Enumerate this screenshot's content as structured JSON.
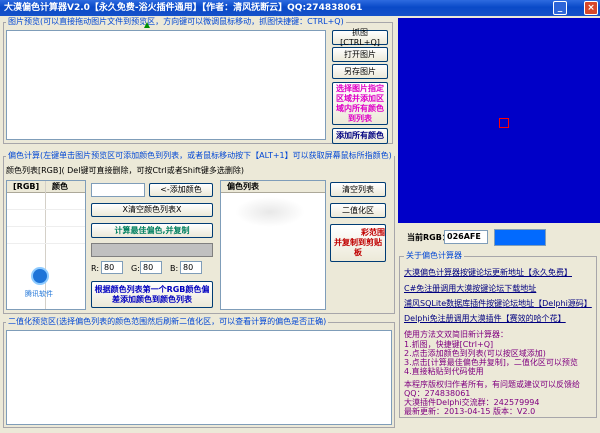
{
  "window": {
    "title": "大漠偏色计算器V2.0【永久免费-浴火插件通用】【作者：清风抚断云】QQ:274838061"
  },
  "preview": {
    "label": "图片预览(可以直接拖动图片文件到预览区，方向键可以微调鼠标移动，抓图快捷键：CTRL+Q)"
  },
  "buttons": {
    "capture": "抓图[CTRL+Q]",
    "open": "打开图片",
    "save_as": "另存图片",
    "select_color_region": "选择图片指定区域并添加区域内所有颜色到列表",
    "add_all_colors": "添加所有颜色",
    "add_color": "<-添加颜色",
    "clear_color_list": "X清空颜色列表X",
    "calc_best_offset": "计算最佳偏色,并复制",
    "add_by_first_rgb": "根据颜色列表第一个RGB颜色偏差添加颜色到颜色列表",
    "clear_list": "清空列表",
    "binarize": "二值化区",
    "add_offset_partial": "彩范围",
    "copy_offset_partial": "并复制到剪贴板"
  },
  "offset_calc": {
    "label": "偏色计算(左键单击图片预览区可添加颜色到列表，或者鼠标移动按下【ALT+1】可以获取屏幕鼠标所指颜色)",
    "list_hint": "颜色列表[RGB]( Del键可直接删除，可按Ctrl或者Shift键多选删除)",
    "col_rgb": "[RGB]",
    "col_color": "颜色",
    "col_offset_list": "偏色列表",
    "r_label": "R:",
    "r_value": "80",
    "g_label": "G:",
    "g_value": "80",
    "b_label": "B:",
    "b_value": "80"
  },
  "watermark": "腾讯软件",
  "current_rgb": {
    "label": "当前RGB：",
    "value": "026AFE",
    "swatch_color": "#026afe"
  },
  "about": {
    "label": "关于偏色计算器",
    "links": [
      "大漠偏色计算器按键论坛更新地址【永久免费】",
      "C#免注册调用大漠按键论坛下载地址",
      "浦风SQLite数据库插件按键论坛地址【Delphi源码】",
      "Delphi免注册调用大漠插件【赛效的哈个花】"
    ],
    "usage_title": "使用方法文双简旧新计算器：",
    "usage": [
      "1.抓图，快捷键[Ctrl+Q]",
      "2.点击添加颜色到列表(可以按区域添加)",
      "3.点击[计算最佳偏色并复制]，二值化区可以预览",
      "4.直接粘贴到代码使用"
    ],
    "footer": [
      "本程序版权归作者所有，有问题或建议可以反馈给",
      "QQ：274838061",
      "大漠插件Delphi交流群：242579994",
      "最新更新：2013-04-15 版本：V2.0"
    ]
  },
  "binarize": {
    "label": "二值化预览区(选择偏色列表的颜色范围然后刷新二值化区，可以查看计算的偏色是否正确)"
  },
  "colors": {
    "title_bar": "#0a4ac8",
    "preview_bg": "#0000c8",
    "accent_label": "#0046d5",
    "marker": "#ff0000"
  }
}
